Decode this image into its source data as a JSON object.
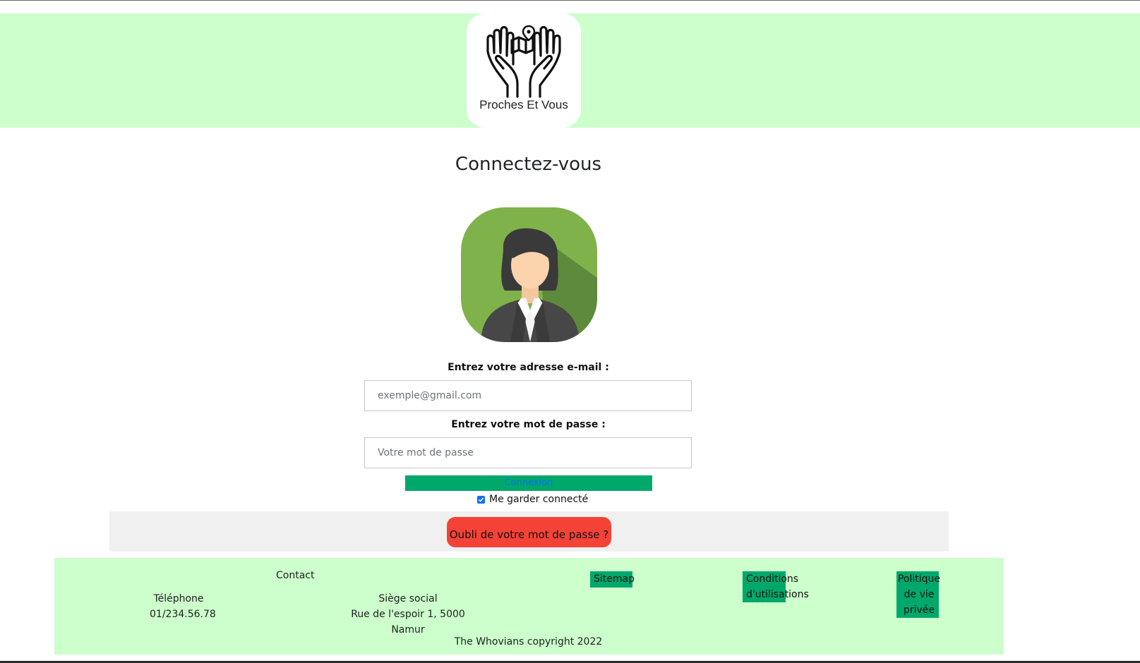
{
  "header": {
    "logo_text": "Proches Et Vous",
    "background": "#ccffcc"
  },
  "login": {
    "title": "Connectez-vous",
    "email_label": "Entrez votre adresse e-mail :",
    "email_placeholder": "exemple@gmail.com",
    "password_label": "Entrez votre mot de passe :",
    "password_placeholder": "Votre mot de passe",
    "submit_label": "Connexion",
    "remember_label": "Me garder connecté",
    "remember_checked": true,
    "forgot_label": "Oubli de votre mot de passe ?"
  },
  "footer": {
    "contact_label": "Contact",
    "phone_label": "Téléphone",
    "phone_value": "01/234.56.78",
    "office_label": "Siège social",
    "office_value": "Rue de l'espoir 1, 5000 Namur",
    "sitemap_label": "Sitemap",
    "conditions_line1": "Conditions",
    "conditions_line2": "d'utilisations",
    "privacy_line1": "Politique",
    "privacy_line2": "de vie",
    "privacy_line3": "privée",
    "copyright": "The Whovians copyright 2022"
  },
  "colors": {
    "accent_green": "#00a86b",
    "header_green": "#ccffcc",
    "danger_red": "#f44336",
    "panel_grey": "#f0f0f0"
  },
  "icons": {
    "logo": "hands-holding-map-icon",
    "avatar": "businesswoman-avatar-icon",
    "checkbox": "checkbox-checked-icon"
  }
}
